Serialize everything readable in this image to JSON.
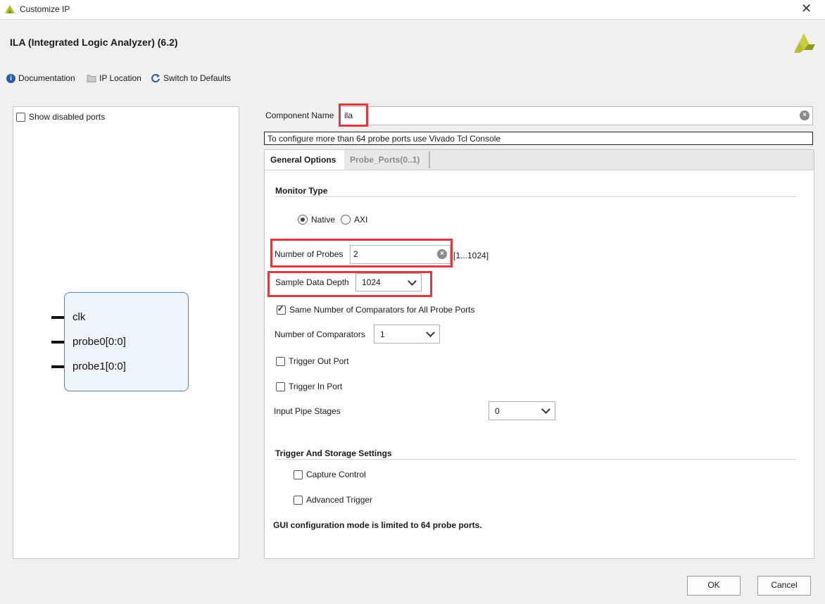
{
  "window": {
    "title": "Customize IP",
    "close_glyph": "✕"
  },
  "header": {
    "ip_title": "ILA (Integrated Logic Analyzer) (6.2)",
    "logo": "xilinx-logo"
  },
  "toolbar": {
    "documentation": "Documentation",
    "ip_location": "IP Location",
    "switch_defaults": "Switch to Defaults"
  },
  "left_panel": {
    "show_disabled_ports": "Show disabled ports",
    "show_disabled_checked": false,
    "ports": [
      "clk",
      "probe0[0:0]",
      "probe1[0:0]"
    ]
  },
  "component": {
    "label": "Component Name",
    "value": "ila"
  },
  "info_text": "To configure more than 64 probe ports use Vivado Tcl Console",
  "tabs": [
    {
      "label": "General Options",
      "active": true
    },
    {
      "label": "Probe_Ports(0..1)",
      "active": false
    }
  ],
  "general": {
    "monitor_type_title": "Monitor Type",
    "monitor_options": [
      {
        "label": "Native",
        "selected": true
      },
      {
        "label": "AXI",
        "selected": false
      }
    ],
    "num_probes_label": "Number of Probes",
    "num_probes_value": "2",
    "num_probes_range": "[1...1024]",
    "sample_depth_label": "Sample Data Depth",
    "sample_depth_value": "1024",
    "same_comparators_label": "Same Number of Comparators for All Probe Ports",
    "same_comparators_checked": true,
    "num_comparators_label": "Number of Comparators",
    "num_comparators_value": "1",
    "trigger_out_label": "Trigger Out Port",
    "trigger_in_label": "Trigger In Port",
    "pipe_stages_label": "Input Pipe Stages",
    "pipe_stages_value": "0",
    "trigger_storage_title": "Trigger And Storage Settings",
    "capture_control_label": "Capture Control",
    "advanced_trigger_label": "Advanced Trigger",
    "gui_note": "GUI configuration mode is limited to 64 probe ports."
  },
  "buttons": {
    "ok": "OK",
    "cancel": "Cancel"
  },
  "colors": {
    "highlight": "#e0393e",
    "symbol_border": "#5b7fb5",
    "logo_yellow": "#b5bd2c"
  }
}
